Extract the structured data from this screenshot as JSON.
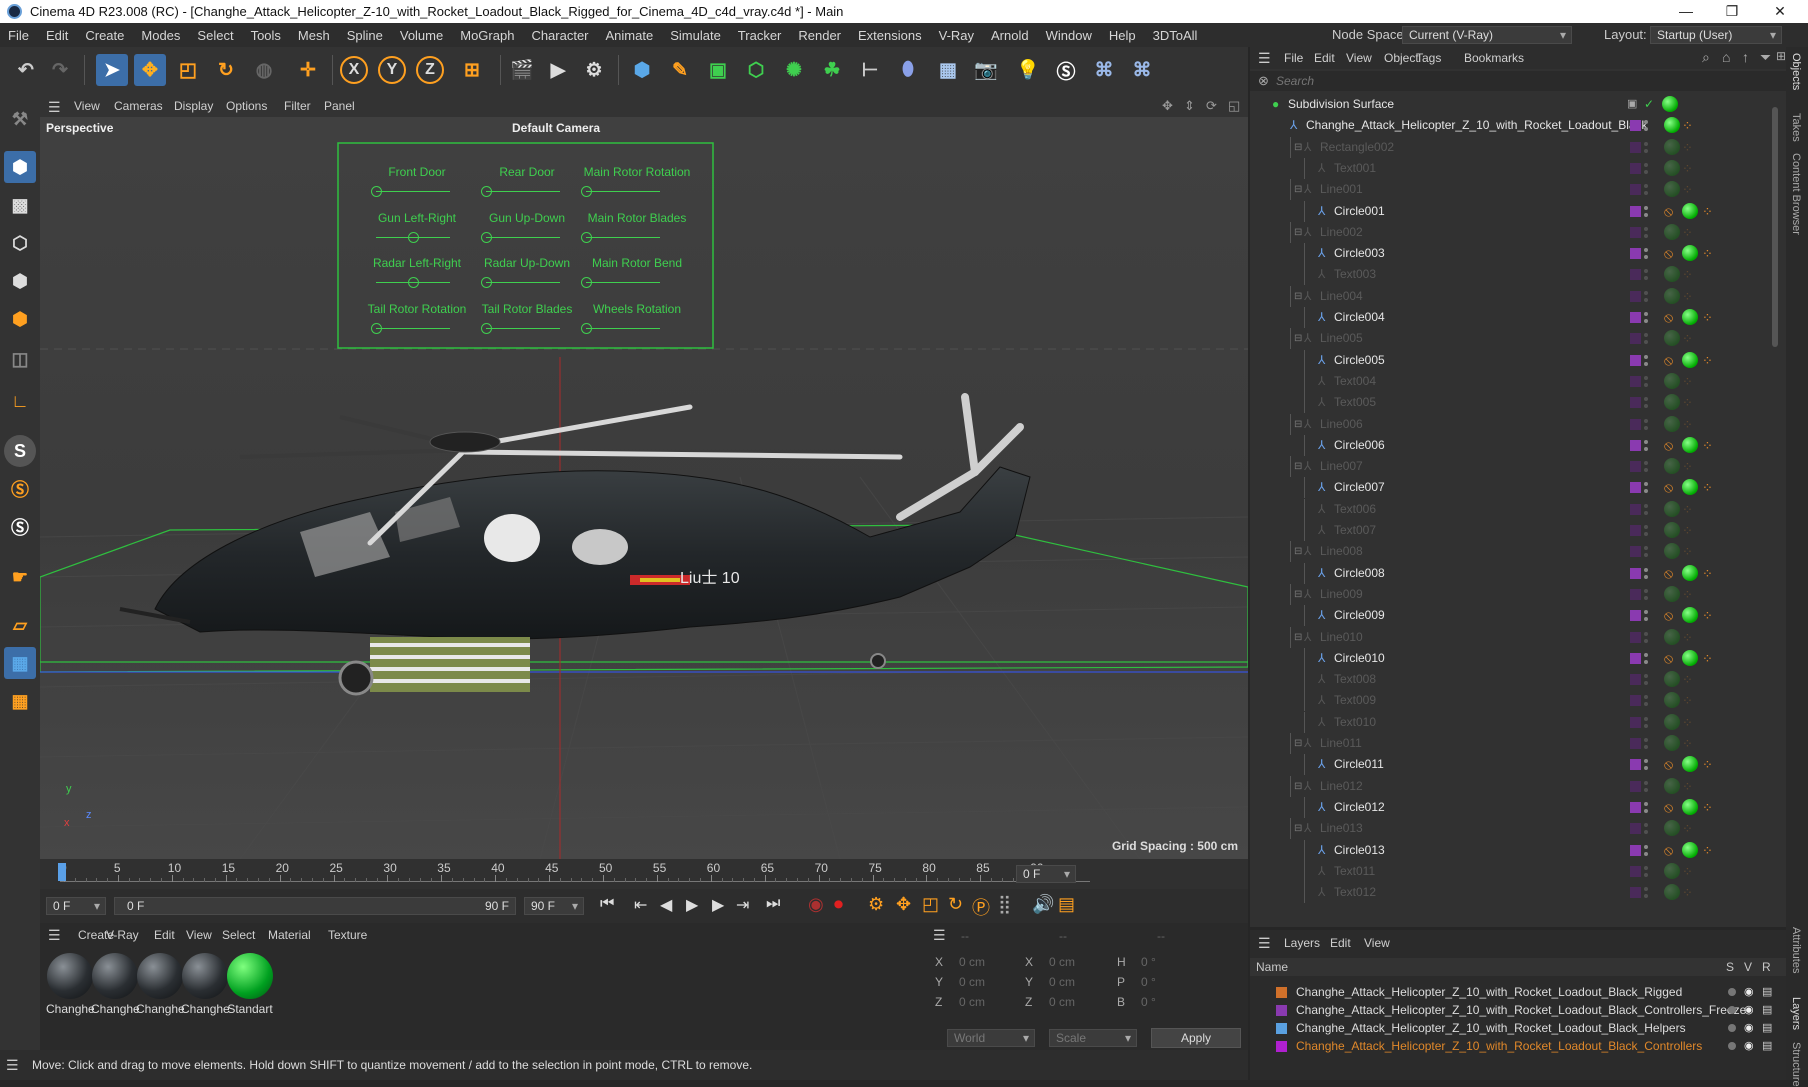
{
  "window": {
    "title": "Cinema 4D R23.008 (RC) - [Changhe_Attack_Helicopter_Z-10_with_Rocket_Loadout_Black_Rigged_for_Cinema_4D_c4d_vray.c4d *] - Main",
    "minimize": "—",
    "maximize": "❐",
    "close": "✕"
  },
  "menu": [
    "File",
    "Edit",
    "Create",
    "Modes",
    "Select",
    "Tools",
    "Mesh",
    "Spline",
    "Volume",
    "MoGraph",
    "Character",
    "Animate",
    "Simulate",
    "Tracker",
    "Render",
    "Extensions",
    "V-Ray",
    "Arnold",
    "Window",
    "Help",
    "3DToAll"
  ],
  "nodespace": {
    "label": "Node Space:",
    "value": "Current (V-Ray)",
    "layout_label": "Layout:",
    "layout_value": "Startup (User)"
  },
  "toolbar": {
    "x": "X",
    "y": "Y",
    "z": "Z"
  },
  "viewport_menu": [
    "View",
    "Cameras",
    "Display",
    "Options",
    "Filter",
    "Panel"
  ],
  "viewport": {
    "name": "Perspective",
    "camera": "Default Camera",
    "grid_spacing": "Grid Spacing : 500 cm",
    "axis_y": "y",
    "axis_z": "z",
    "axis_x": "x"
  },
  "controller": {
    "labels": [
      "Front Door",
      "Rear Door",
      "Main Rotor Rotation",
      "Gun Left-Right",
      "Gun  Up-Down",
      "Main Rotor Blades",
      "Radar Left-Right",
      "Radar Up-Down",
      "Main Rotor Bend",
      "Tail Rotor Rotation",
      "Tail Rotor Blades",
      "Wheels Rotation"
    ],
    "positions": [
      0,
      0,
      0,
      0.5,
      0,
      0,
      0.5,
      0,
      0,
      0,
      0,
      0
    ]
  },
  "timeline": {
    "ticks": [
      "0",
      "5",
      "10",
      "15",
      "20",
      "25",
      "30",
      "35",
      "40",
      "45",
      "50",
      "55",
      "60",
      "65",
      "70",
      "75",
      "80",
      "85",
      "90"
    ],
    "current": "0 F"
  },
  "transport": {
    "start": "0 F",
    "range_start": "0 F",
    "range_end": "90 F",
    "end": "90 F"
  },
  "materials": {
    "menu": [
      "Create",
      "V-Ray",
      "Edit",
      "View",
      "Select",
      "Material",
      "Texture"
    ],
    "items": [
      "Changhe",
      "Changhe",
      "Changhe",
      "Changhe",
      "Standart"
    ]
  },
  "coords": {
    "header1": "--",
    "header2": "--",
    "header3": "--",
    "rows": [
      [
        "X",
        "0 cm",
        "X",
        "0 cm",
        "H",
        "0 °"
      ],
      [
        "Y",
        "0 cm",
        "Y",
        "0 cm",
        "P",
        "0 °"
      ],
      [
        "Z",
        "0 cm",
        "Z",
        "0 cm",
        "B",
        "0 °"
      ]
    ],
    "world": "World",
    "scale": "Scale",
    "apply": "Apply"
  },
  "status": "Move: Click and drag to move elements. Hold down SHIFT to quantize movement / add to the selection in point mode, CTRL to remove.",
  "objects": {
    "menu": [
      "File",
      "Edit",
      "View",
      "Object",
      "Tags",
      "Bookmarks"
    ],
    "search_placeholder": "Search",
    "rows": [
      {
        "name": "Subdivision Surface",
        "indent": 0,
        "type": "sub",
        "active": true
      },
      {
        "name": "Changhe_Attack_Helicopter_Z_10_with_Rocket_Loadout_Black",
        "indent": 1,
        "type": "null",
        "active": true
      },
      {
        "name": "Rectangle002",
        "indent": 2,
        "type": "spline",
        "active": false
      },
      {
        "name": "Text001",
        "indent": 3,
        "type": "spline",
        "active": false
      },
      {
        "name": "Line001",
        "indent": 2,
        "type": "spline",
        "active": false
      },
      {
        "name": "Circle001",
        "indent": 3,
        "type": "circle",
        "active": true
      },
      {
        "name": "Line002",
        "indent": 2,
        "type": "spline",
        "active": false
      },
      {
        "name": "Circle003",
        "indent": 3,
        "type": "circle",
        "active": true
      },
      {
        "name": "Text003",
        "indent": 3,
        "type": "spline",
        "active": false
      },
      {
        "name": "Line004",
        "indent": 2,
        "type": "spline",
        "active": false
      },
      {
        "name": "Circle004",
        "indent": 3,
        "type": "circle",
        "active": true
      },
      {
        "name": "Line005",
        "indent": 2,
        "type": "spline",
        "active": false
      },
      {
        "name": "Circle005",
        "indent": 3,
        "type": "circle",
        "active": true
      },
      {
        "name": "Text004",
        "indent": 3,
        "type": "spline",
        "active": false
      },
      {
        "name": "Text005",
        "indent": 3,
        "type": "spline",
        "active": false
      },
      {
        "name": "Line006",
        "indent": 2,
        "type": "spline",
        "active": false
      },
      {
        "name": "Circle006",
        "indent": 3,
        "type": "circle",
        "active": true
      },
      {
        "name": "Line007",
        "indent": 2,
        "type": "spline",
        "active": false
      },
      {
        "name": "Circle007",
        "indent": 3,
        "type": "circle",
        "active": true
      },
      {
        "name": "Text006",
        "indent": 3,
        "type": "spline",
        "active": false
      },
      {
        "name": "Text007",
        "indent": 3,
        "type": "spline",
        "active": false
      },
      {
        "name": "Line008",
        "indent": 2,
        "type": "spline",
        "active": false
      },
      {
        "name": "Circle008",
        "indent": 3,
        "type": "circle",
        "active": true
      },
      {
        "name": "Line009",
        "indent": 2,
        "type": "spline",
        "active": false
      },
      {
        "name": "Circle009",
        "indent": 3,
        "type": "circle",
        "active": true
      },
      {
        "name": "Line010",
        "indent": 2,
        "type": "spline",
        "active": false
      },
      {
        "name": "Circle010",
        "indent": 3,
        "type": "circle",
        "active": true
      },
      {
        "name": "Text008",
        "indent": 3,
        "type": "spline",
        "active": false
      },
      {
        "name": "Text009",
        "indent": 3,
        "type": "spline",
        "active": false
      },
      {
        "name": "Text010",
        "indent": 3,
        "type": "spline",
        "active": false
      },
      {
        "name": "Line011",
        "indent": 2,
        "type": "spline",
        "active": false
      },
      {
        "name": "Circle011",
        "indent": 3,
        "type": "circle",
        "active": true
      },
      {
        "name": "Line012",
        "indent": 2,
        "type": "spline",
        "active": false
      },
      {
        "name": "Circle012",
        "indent": 3,
        "type": "circle",
        "active": true
      },
      {
        "name": "Line013",
        "indent": 2,
        "type": "spline",
        "active": false
      },
      {
        "name": "Circle013",
        "indent": 3,
        "type": "circle",
        "active": true
      },
      {
        "name": "Text011",
        "indent": 3,
        "type": "spline",
        "active": false
      },
      {
        "name": "Text012",
        "indent": 3,
        "type": "spline",
        "active": false
      }
    ]
  },
  "layers": {
    "menu": [
      "Layers",
      "Edit",
      "View"
    ],
    "col_name": "Name",
    "col_s": "S",
    "col_v": "V",
    "col_r": "R",
    "items": [
      {
        "name": "Changhe_Attack_Helicopter_Z_10_with_Rocket_Loadout_Black_Rigged",
        "color": "#d0702a",
        "highlight": false
      },
      {
        "name": "Changhe_Attack_Helicopter_Z_10_with_Rocket_Loadout_Black_Controllers_Freeze",
        "color": "#8a3ab0",
        "highlight": false
      },
      {
        "name": "Changhe_Attack_Helicopter_Z_10_with_Rocket_Loadout_Black_Helpers",
        "color": "#5aa0e0",
        "highlight": false
      },
      {
        "name": "Changhe_Attack_Helicopter_Z_10_with_Rocket_Loadout_Black_Controllers",
        "color": "#b020d0",
        "highlight": true
      }
    ]
  },
  "side_tabs": [
    "Objects",
    "Takes",
    "Content Browser",
    "Attributes",
    "Layers",
    "Structure"
  ],
  "colors": {
    "accent": "#2d8ae0",
    "controller_green": "#3fcf4f",
    "layer_highlight": "#e0882a"
  }
}
